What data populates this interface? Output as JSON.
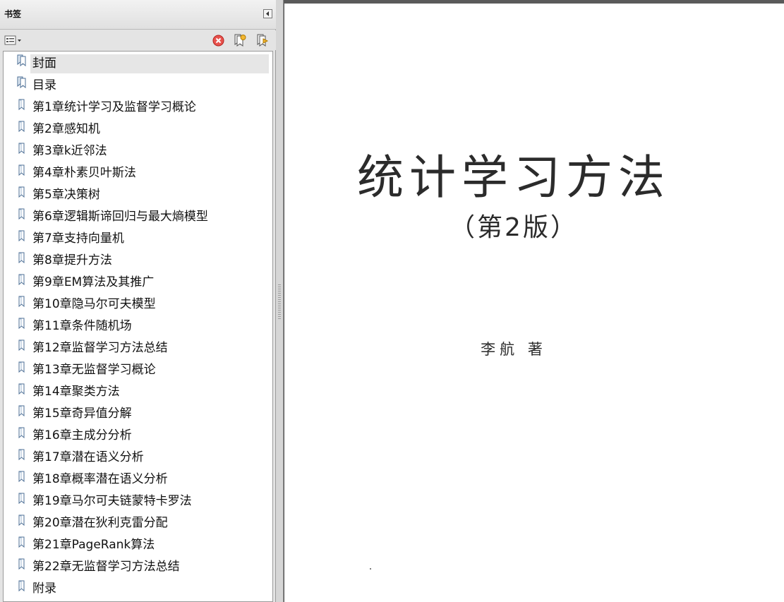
{
  "panel": {
    "title": "书签"
  },
  "bookmarks": [
    {
      "label": "封面",
      "selected": true,
      "icon": "bookmark-multi-icon"
    },
    {
      "label": "目录",
      "icon": "bookmark-multi-icon"
    },
    {
      "label": "第1章统计学习及监督学习概论",
      "icon": "bookmark-icon"
    },
    {
      "label": "第2章感知机",
      "icon": "bookmark-icon"
    },
    {
      "label": "第3章k近邻法",
      "icon": "bookmark-icon"
    },
    {
      "label": "第4章朴素贝叶斯法",
      "icon": "bookmark-icon"
    },
    {
      "label": "第5章决策树",
      "icon": "bookmark-icon"
    },
    {
      "label": "第6章逻辑斯谛回归与最大熵模型",
      "icon": "bookmark-icon"
    },
    {
      "label": "第7章支持向量机",
      "icon": "bookmark-icon"
    },
    {
      "label": "第8章提升方法",
      "icon": "bookmark-icon"
    },
    {
      "label": "第9章EM算法及其推广",
      "icon": "bookmark-icon"
    },
    {
      "label": "第10章隐马尔可夫模型",
      "icon": "bookmark-icon"
    },
    {
      "label": "第11章条件随机场",
      "icon": "bookmark-icon"
    },
    {
      "label": "第12章监督学习方法总结",
      "icon": "bookmark-icon"
    },
    {
      "label": "第13章无监督学习概论",
      "icon": "bookmark-icon"
    },
    {
      "label": "第14章聚类方法",
      "icon": "bookmark-icon"
    },
    {
      "label": "第15章奇异值分解",
      "icon": "bookmark-icon"
    },
    {
      "label": "第16章主成分分析",
      "icon": "bookmark-icon"
    },
    {
      "label": "第17章潜在语义分析",
      "icon": "bookmark-icon"
    },
    {
      "label": "第18章概率潜在语义分析",
      "icon": "bookmark-icon"
    },
    {
      "label": "第19章马尔可夫链蒙特卡罗法",
      "icon": "bookmark-icon"
    },
    {
      "label": "第20章潜在狄利克雷分配",
      "icon": "bookmark-icon"
    },
    {
      "label": "第21章PageRank算法",
      "icon": "bookmark-icon"
    },
    {
      "label": "第22章无监督学习方法总结",
      "icon": "bookmark-icon"
    },
    {
      "label": "附录",
      "icon": "bookmark-icon"
    }
  ],
  "page": {
    "title": "统计学习方法",
    "edition": "（第2版）",
    "author": "李航 著"
  },
  "colors": {
    "panel_bg": "#e4e4e4",
    "viewer_bg": "#5a5a5a",
    "delete_red": "#d9302c",
    "bookmark_blue": "#4d7fb0"
  }
}
